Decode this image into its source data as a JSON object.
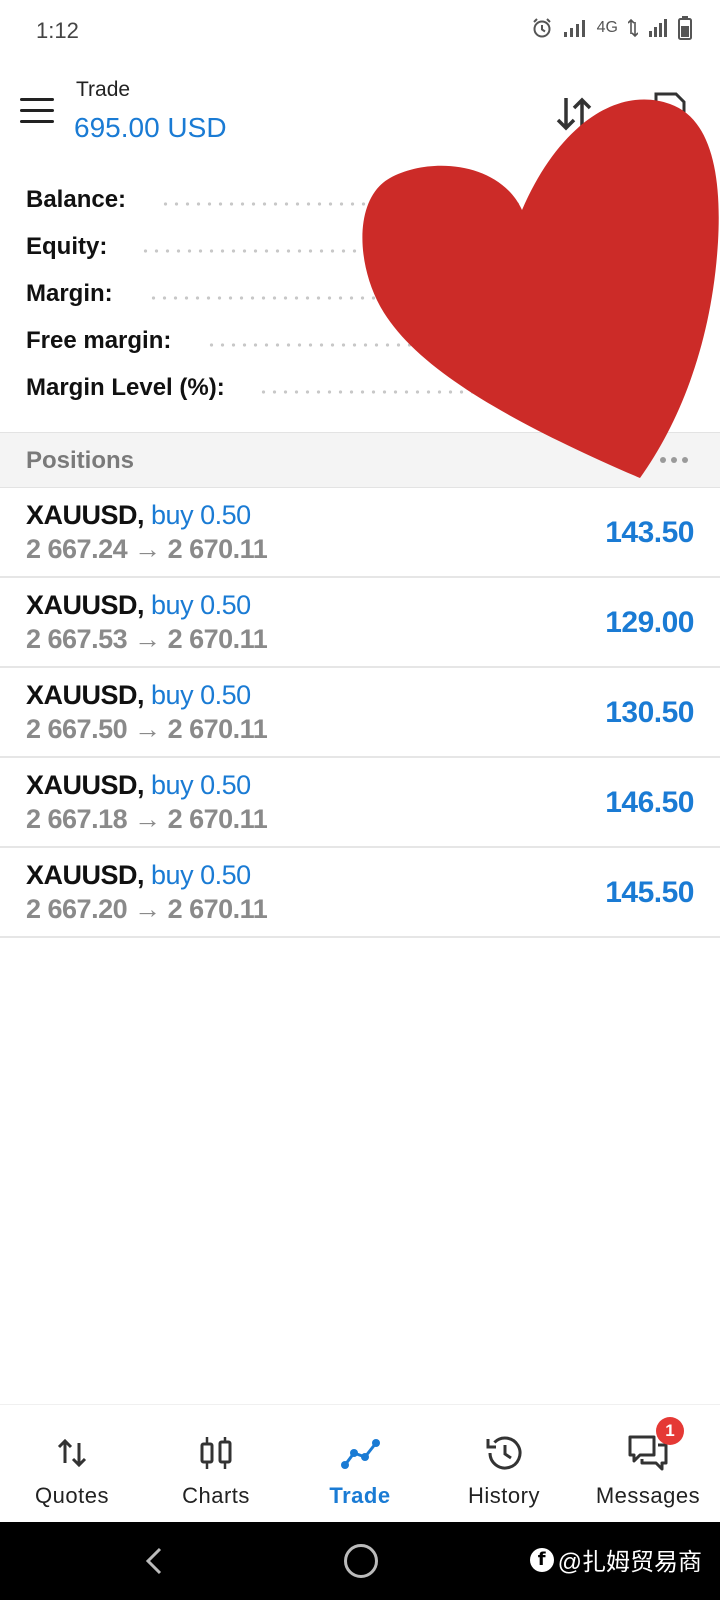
{
  "status_bar": {
    "time": "1:12",
    "network": "4G"
  },
  "header": {
    "title": "Trade",
    "balance": "695.00 USD"
  },
  "summary": [
    {
      "label": "Balance:"
    },
    {
      "label": "Equity:"
    },
    {
      "label": "Margin:"
    },
    {
      "label": "Free margin:"
    },
    {
      "label": "Margin Level (%):"
    }
  ],
  "positions": {
    "title": "Positions",
    "items": [
      {
        "symbol": "XAUUSD,",
        "side": "buy 0.50",
        "prices": "2 667.24 → 2 670.11",
        "profit": "143.50"
      },
      {
        "symbol": "XAUUSD,",
        "side": "buy 0.50",
        "prices": "2 667.53 → 2 670.11",
        "profit": "129.00"
      },
      {
        "symbol": "XAUUSD,",
        "side": "buy 0.50",
        "prices": "2 667.50 → 2 670.11",
        "profit": "130.50"
      },
      {
        "symbol": "XAUUSD,",
        "side": "buy 0.50",
        "prices": "2 667.18 → 2 670.11",
        "profit": "146.50"
      },
      {
        "symbol": "XAUUSD,",
        "side": "buy 0.50",
        "prices": "2 667.20 → 2 670.11",
        "profit": "145.50"
      }
    ]
  },
  "bottom_nav": {
    "items": [
      {
        "label": "Quotes",
        "icon": "quotes-icon"
      },
      {
        "label": "Charts",
        "icon": "charts-icon"
      },
      {
        "label": "Trade",
        "icon": "trade-icon",
        "active": true
      },
      {
        "label": "History",
        "icon": "history-icon"
      },
      {
        "label": "Messages",
        "icon": "messages-icon",
        "badge": "1"
      }
    ]
  },
  "watermark": {
    "text": "@扎姆贸易商",
    "icon": "f"
  },
  "colors": {
    "accent": "#1a7bd4",
    "heart": "#cc2b28",
    "badge": "#e53935"
  }
}
